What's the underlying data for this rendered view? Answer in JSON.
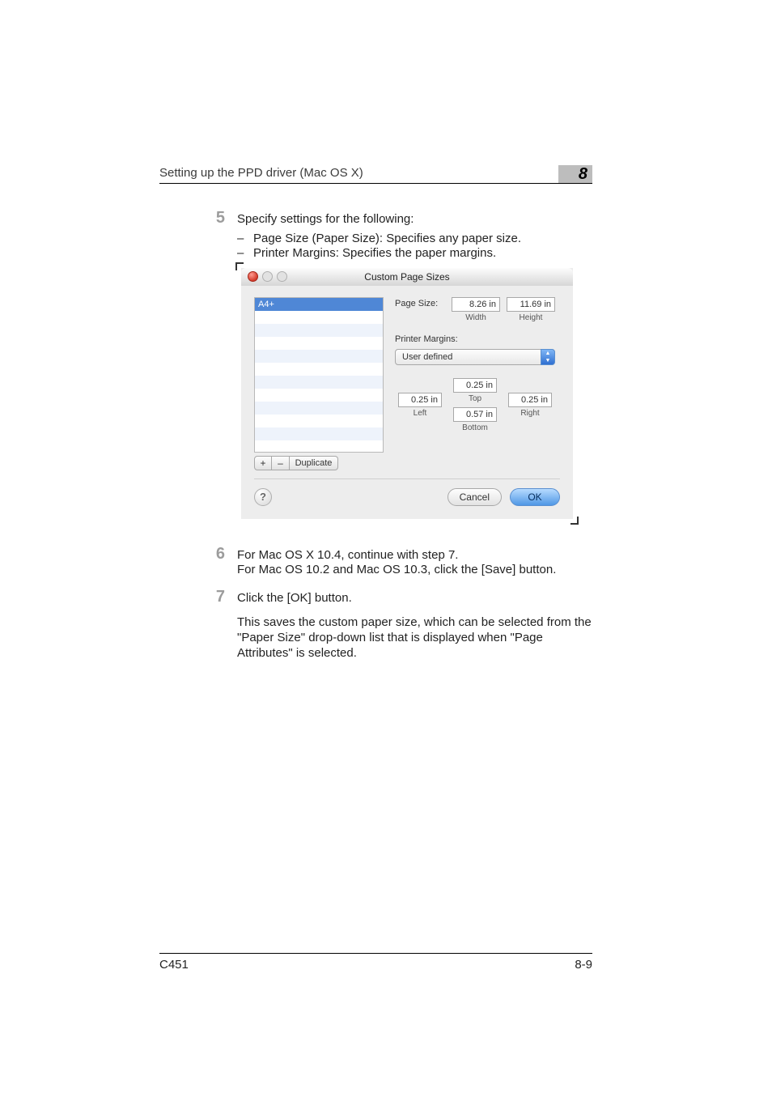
{
  "header": {
    "title": "Setting up the PPD driver (Mac OS X)",
    "chapter_number": "8"
  },
  "step5": {
    "number": "5",
    "text": "Specify settings for the following:",
    "bullets": [
      "Page Size (Paper Size): Specifies any paper size.",
      "Printer Margins: Specifies the paper margins."
    ]
  },
  "dialog": {
    "window_title": "Custom Page Sizes",
    "list": {
      "selected": "A4+"
    },
    "controls": {
      "plus": "+",
      "minus": "–",
      "duplicate": "Duplicate"
    },
    "page_size": {
      "label": "Page Size:",
      "width_value": "8.26 in",
      "width_label": "Width",
      "height_value": "11.69 in",
      "height_label": "Height"
    },
    "printer_margins": {
      "label": "Printer Margins:",
      "dropdown": "User defined",
      "top_value": "0.25 in",
      "top_label": "Top",
      "left_value": "0.25 in",
      "left_label": "Left",
      "right_value": "0.25 in",
      "right_label": "Right",
      "bottom_value": "0.57 in",
      "bottom_label": "Bottom"
    },
    "help": "?",
    "cancel": "Cancel",
    "ok": "OK"
  },
  "step6": {
    "number": "6",
    "line1": "For Mac OS X 10.4, continue with step 7.",
    "line2": "For Mac OS 10.2 and Mac OS 10.3, click the [Save] button."
  },
  "step7": {
    "number": "7",
    "line1": "Click the [OK] button.",
    "para": "This saves the custom paper size, which can be selected from the \"Paper Size\" drop-down list that is displayed when \"Page Attributes\" is selected."
  },
  "footer": {
    "left": "C451",
    "right": "8-9"
  }
}
